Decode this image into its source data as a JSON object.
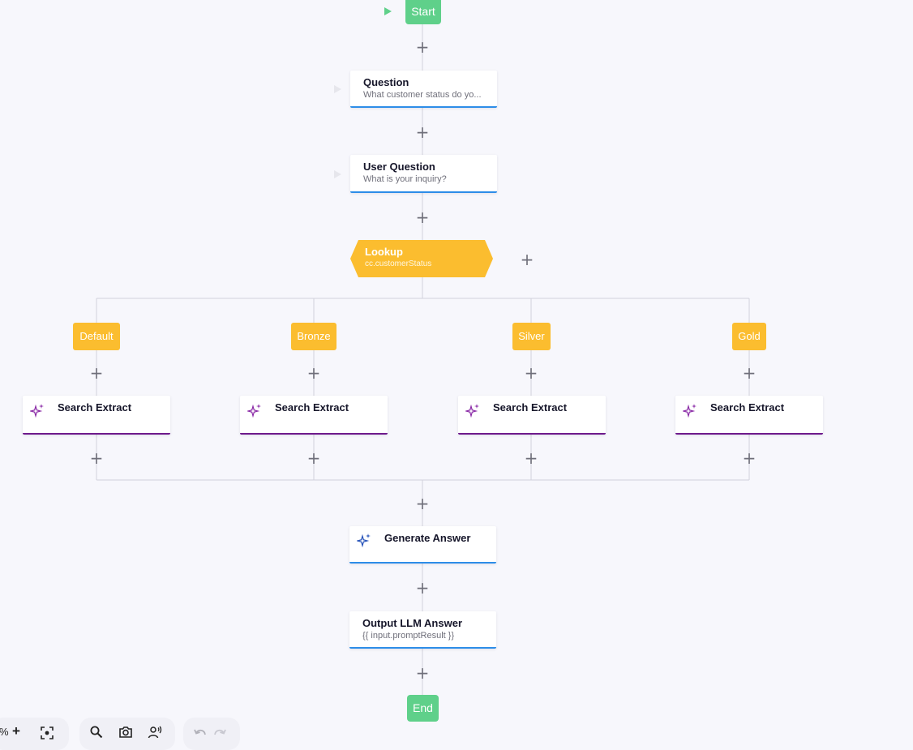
{
  "flow": {
    "start_label": "Start",
    "end_label": "End",
    "question": {
      "title": "Question",
      "subtitle": "What customer status do yo..."
    },
    "user_question": {
      "title": "User Question",
      "subtitle": "What is your inquiry?"
    },
    "lookup": {
      "title": "Lookup",
      "subtitle": "cc.customerStatus"
    },
    "branches": [
      "Default",
      "Bronze",
      "Silver",
      "Gold"
    ],
    "branch_card_title": "Search Extract",
    "generate_answer": {
      "title": "Generate Answer"
    },
    "output": {
      "title": "Output LLM Answer",
      "subtitle": "{{ input.promptResult }}"
    },
    "add_symbol": "+"
  },
  "toolbar": {
    "zoom_fragment": "%",
    "zoom_in_symbol": "+",
    "icons": [
      "fit-view-icon",
      "search-icon",
      "camera-icon",
      "voice-user-icon",
      "undo-icon",
      "redo-icon"
    ]
  },
  "colors": {
    "green": "#5fd08a",
    "yellow": "#fbbd2f",
    "blue_accent": "#2d8de8",
    "purple_accent": "#6e1a8c",
    "connector": "#d2d2dc"
  }
}
